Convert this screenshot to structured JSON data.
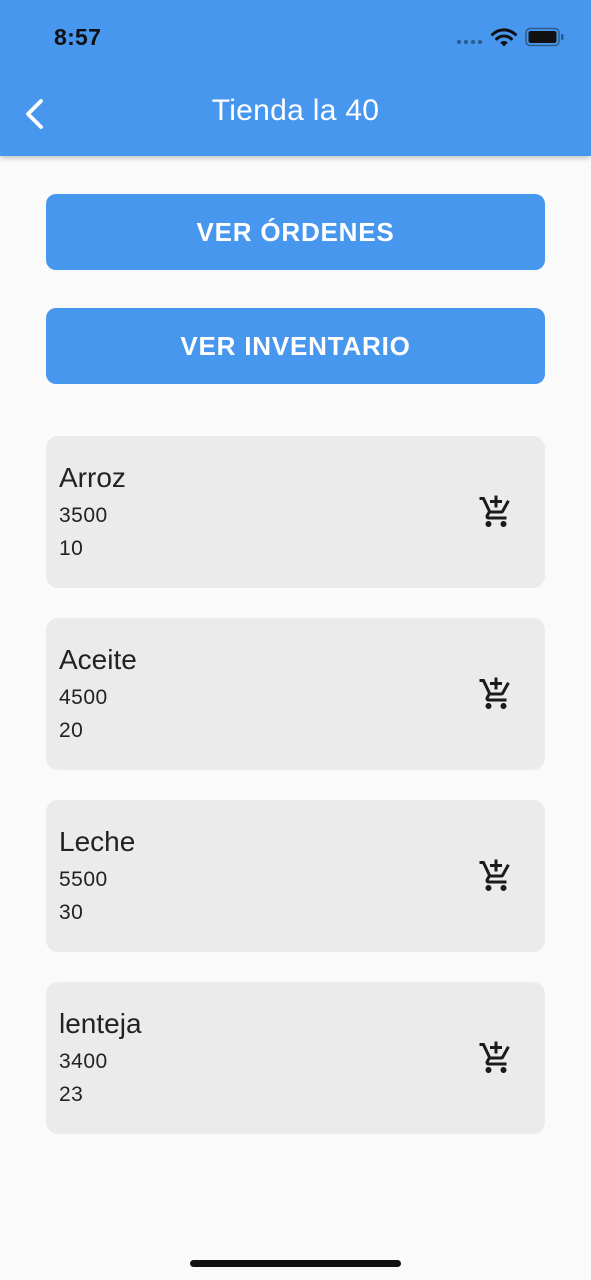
{
  "status_bar": {
    "time": "8:57"
  },
  "app_bar": {
    "title": "Tienda la 40",
    "back_icon": "chevron-left-icon"
  },
  "buttons": {
    "orders_label": "VER ÓRDENES",
    "inventory_label": "VER INVENTARIO"
  },
  "products": [
    {
      "name": "Arroz",
      "price": "3500",
      "quantity": "10",
      "action_icon": "add-to-cart-icon"
    },
    {
      "name": "Aceite",
      "price": "4500",
      "quantity": "20",
      "action_icon": "add-to-cart-icon"
    },
    {
      "name": "Leche",
      "price": "5500",
      "quantity": "30",
      "action_icon": "add-to-cart-icon"
    },
    {
      "name": "lenteja",
      "price": "3400",
      "quantity": "23",
      "action_icon": "add-to-cart-icon"
    }
  ],
  "colors": {
    "primary": "#4797ef",
    "card_background": "#ebebeb",
    "page_background": "#fafafa"
  }
}
